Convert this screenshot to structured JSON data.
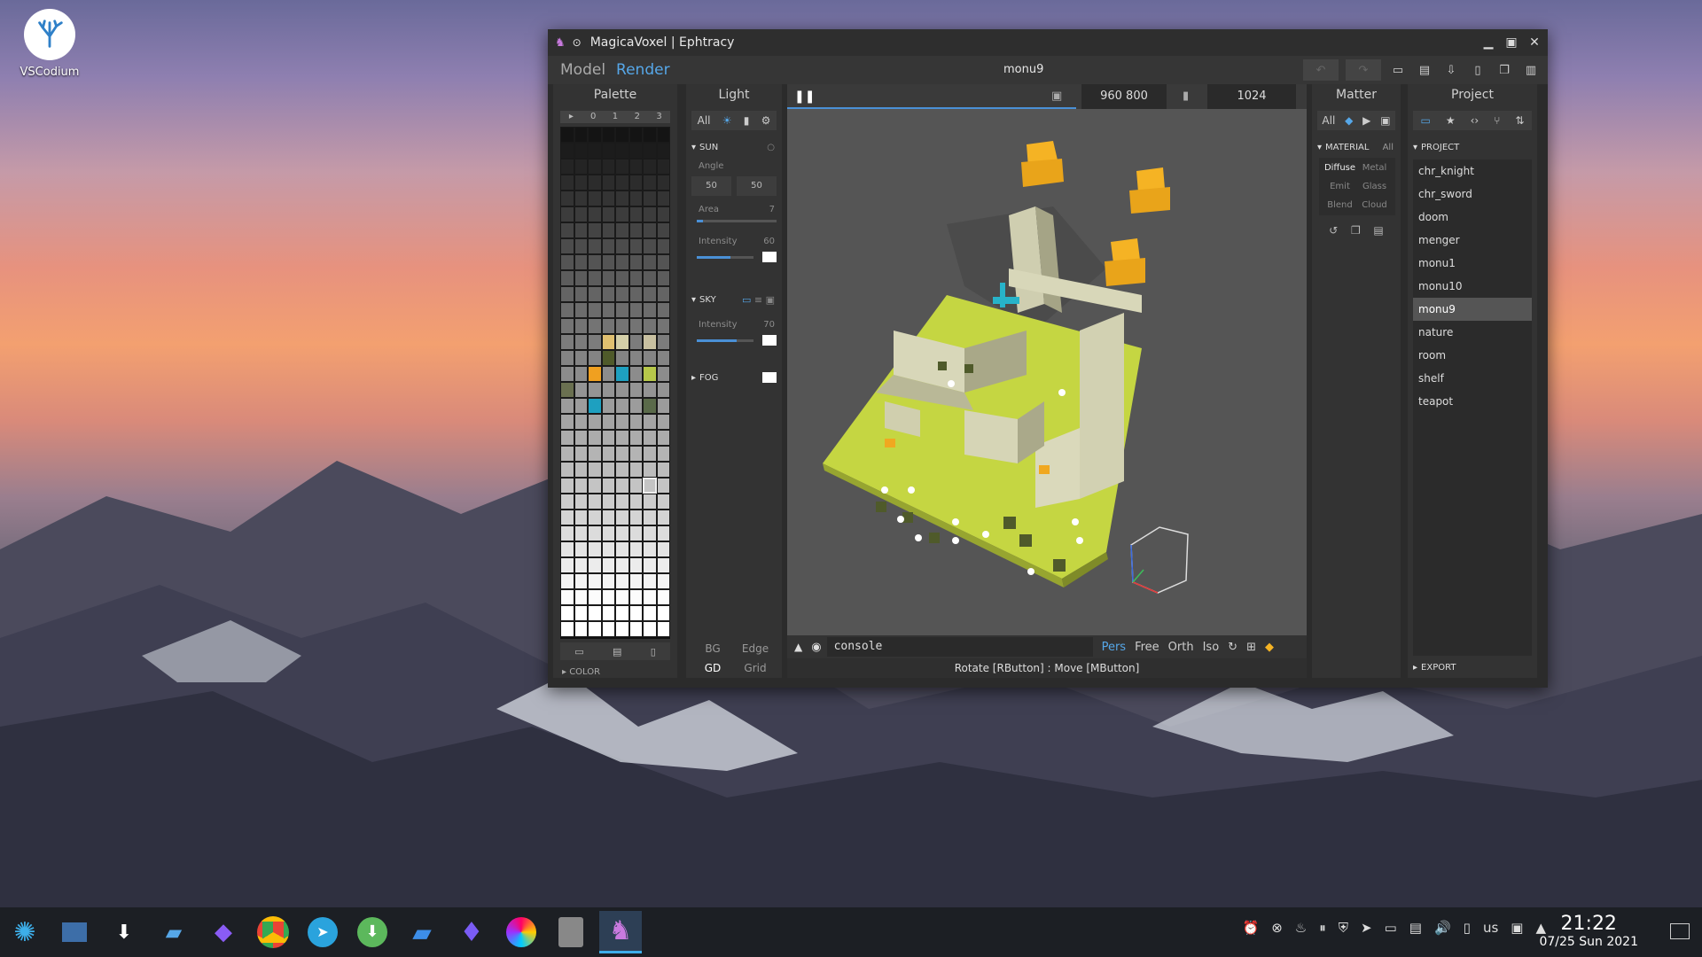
{
  "desktop": {
    "icon_label": "VSCodium"
  },
  "window": {
    "title": "MagicaVoxel | Ephtracy",
    "modes": [
      "Model",
      "Render"
    ],
    "scene_name": "monu9"
  },
  "palette": {
    "header": "Palette",
    "tabs": [
      "▸",
      "0",
      "1",
      "2",
      "3"
    ],
    "color_section": "COLOR"
  },
  "light": {
    "header": "Light",
    "filter_all": "All",
    "sun": {
      "title": "SUN",
      "angle_label": "Angle",
      "angle_a": "50",
      "angle_b": "50",
      "area_label": "Area",
      "area_value": "7",
      "intensity_label": "Intensity",
      "intensity_value": "60"
    },
    "sky": {
      "title": "SKY",
      "intensity_label": "Intensity",
      "intensity_value": "70"
    },
    "fog": {
      "title": "FOG"
    },
    "bottom": [
      "BG",
      "Edge",
      "GD",
      "Grid"
    ]
  },
  "render": {
    "resolution": "960  800",
    "sample_count": "1024",
    "console_text": "console",
    "camera_modes": [
      "Pers",
      "Free",
      "Orth",
      "Iso"
    ],
    "status": "Rotate [RButton] : Move [MButton]"
  },
  "matter": {
    "header": "Matter",
    "filter_all": "All",
    "material_label": "MATERIAL",
    "material_all": "All",
    "types": [
      "Diffuse",
      "Metal",
      "Emit",
      "Glass",
      "Blend",
      "Cloud"
    ]
  },
  "project": {
    "header": "Project",
    "section": "PROJECT",
    "items": [
      "chr_knight",
      "chr_sword",
      "doom",
      "menger",
      "monu1",
      "monu10",
      "monu9",
      "nature",
      "room",
      "shelf",
      "teapot"
    ],
    "selected": "monu9",
    "export_label": "EXPORT"
  },
  "taskbar": {
    "keyboard_layout": "us",
    "time": "21:22",
    "date": "07/25 Sun 2021"
  },
  "colors": {
    "accent": "#56a7e8",
    "ground": "#c5d642",
    "block": "#d2d1b2",
    "orange": "#f5b324"
  }
}
